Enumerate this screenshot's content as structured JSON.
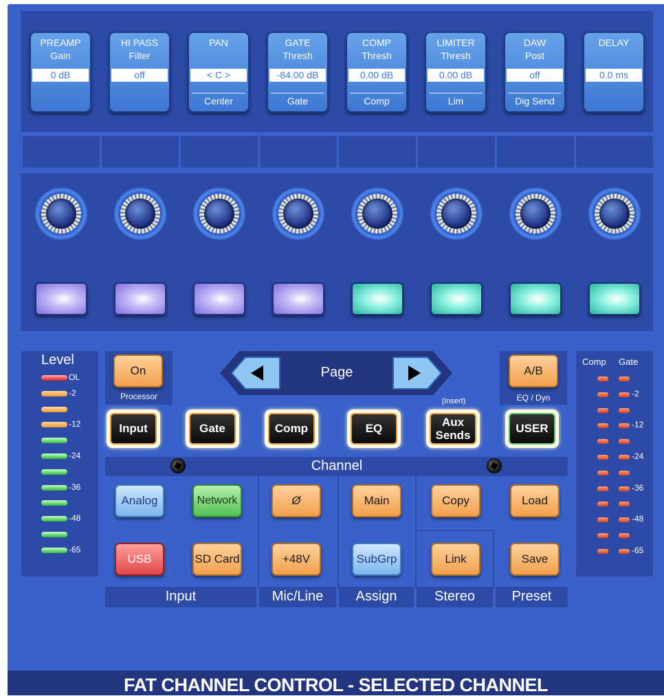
{
  "colors": {
    "panel": "#3a61c9",
    "section": "#2c4aa6",
    "footer": "#24357f",
    "orange": "#f2a04c",
    "teal": "#28b3a0",
    "purple": "#7f6de0"
  },
  "displays": [
    {
      "line1": "PREAMP",
      "line2": "Gain",
      "value": "0 dB",
      "line3": ""
    },
    {
      "line1": "HI PASS",
      "line2": "Filter",
      "value": "off",
      "line3": ""
    },
    {
      "line1": "PAN",
      "line2": "",
      "value": "< C >",
      "line3": "Center"
    },
    {
      "line1": "GATE",
      "line2": "Thresh",
      "value": "-84.00 dB",
      "line3": "Gate"
    },
    {
      "line1": "COMP",
      "line2": "Thresh",
      "value": "0.00 dB",
      "line3": "Comp"
    },
    {
      "line1": "LIMITER",
      "line2": "Thresh",
      "value": "0.00 dB",
      "line3": "Lim"
    },
    {
      "line1": "DAW",
      "line2": "Post",
      "value": "off",
      "line3": "Dig Send"
    },
    {
      "line1": "DELAY",
      "line2": "",
      "value": "0.0 ms",
      "line3": ""
    }
  ],
  "level_meter": {
    "title": "Level",
    "labels": [
      "OL",
      "-2",
      "",
      "-12",
      "",
      "-24",
      "",
      "-36",
      "",
      "-48",
      "",
      "-65"
    ]
  },
  "comp_gate_meter": {
    "comp_label": "Comp",
    "gate_label": "Gate",
    "labels": [
      "",
      "-2",
      "",
      "-12",
      "",
      "-24",
      "",
      "-36",
      "",
      "-48",
      "",
      "-65"
    ]
  },
  "processor": {
    "on_label": "On",
    "caption": "Processor"
  },
  "page": {
    "label": "Page"
  },
  "ab": {
    "label": "A/B",
    "caption": "EQ / Dyn"
  },
  "insert_caption": "(Insert)",
  "channel_buttons": {
    "input": "Input",
    "gate": "Gate",
    "comp": "Comp",
    "eq": "EQ",
    "aux1": "Aux",
    "aux2": "Sends",
    "user": "USER"
  },
  "channel_label": "Channel",
  "input_buttons": {
    "analog": "Analog",
    "network": "Network",
    "usb": "USB",
    "sdcard": "SD Card"
  },
  "micline_buttons": {
    "phase": "Ø",
    "phantom": "+48V"
  },
  "assign_buttons": {
    "main": "Main",
    "subgrp": "SubGrp"
  },
  "stereo_buttons": {
    "copy": "Copy",
    "link": "Link"
  },
  "preset_buttons": {
    "load": "Load",
    "save": "Save"
  },
  "section_labels": {
    "input": "Input",
    "micline": "Mic/Line",
    "assign": "Assign",
    "stereo": "Stereo",
    "preset": "Preset"
  },
  "footer": "FAT CHANNEL CONTROL - SELECTED CHANNEL"
}
